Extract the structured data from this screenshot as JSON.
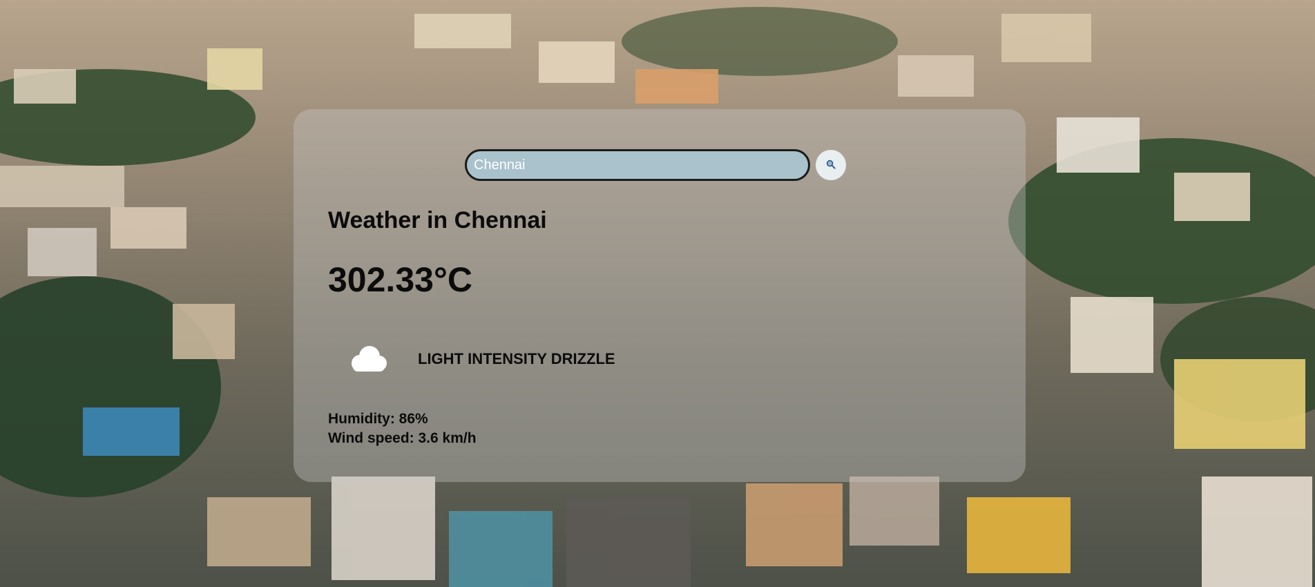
{
  "colors": {
    "card_background": "rgba(200,200,200,0.38)",
    "input_background": "#a9c2cc",
    "input_border": "#1b1b1b",
    "button_background": "#e9eef1",
    "text": "#0b0b0b"
  },
  "search": {
    "value": "Chennai",
    "button_icon": "magnifier-icon"
  },
  "weather": {
    "title": "Weather in Chennai",
    "temperature": "302.33°C",
    "icon": "cloud-icon",
    "description": "LIGHT INTENSITY DRIZZLE",
    "humidity": "Humidity: 86%",
    "wind_speed": "Wind speed: 3.6 km/h"
  }
}
